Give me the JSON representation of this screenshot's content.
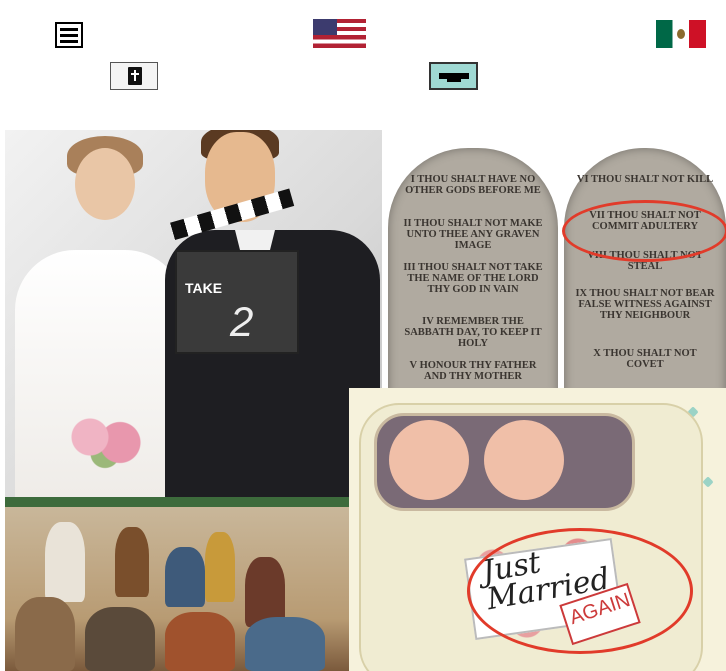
{
  "nav": {
    "menu_icon": "hamburger-menu-icon",
    "english_flag_icon": "us-flag-icon",
    "spanish_flag_icon": "mexico-flag-icon",
    "bible_icon": "bible-icon",
    "video_icon": "video-screen-icon"
  },
  "collage": {
    "wedding": {
      "clapper_take": "TAKE",
      "clapper_number": "2"
    },
    "tablets": {
      "left": [
        "I THOU SHALT HAVE NO OTHER GODS BEFORE ME",
        "II THOU SHALT NOT MAKE UNTO THEE ANY GRAVEN IMAGE",
        "III THOU SHALT NOT TAKE THE NAME OF THE LORD THY GOD IN VAIN",
        "IV REMEMBER THE SABBATH DAY, TO KEEP IT HOLY",
        "V HONOUR THY FATHER AND THY MOTHER"
      ],
      "right": [
        "VI THOU SHALT NOT KILL",
        "VII THOU SHALT NOT COMMIT ADULTERY",
        "VIII THOU SHALT NOT STEAL",
        "IX THOU SHALT NOT BEAR FALSE WITNESS AGAINST THY NEIGHBOUR",
        "X THOU SHALT NOT COVET"
      ]
    },
    "car": {
      "sign_line1": "Just",
      "sign_line2": "Married",
      "again": "AGAIN"
    }
  },
  "colors": {
    "highlight_circle": "#e13b2a"
  }
}
